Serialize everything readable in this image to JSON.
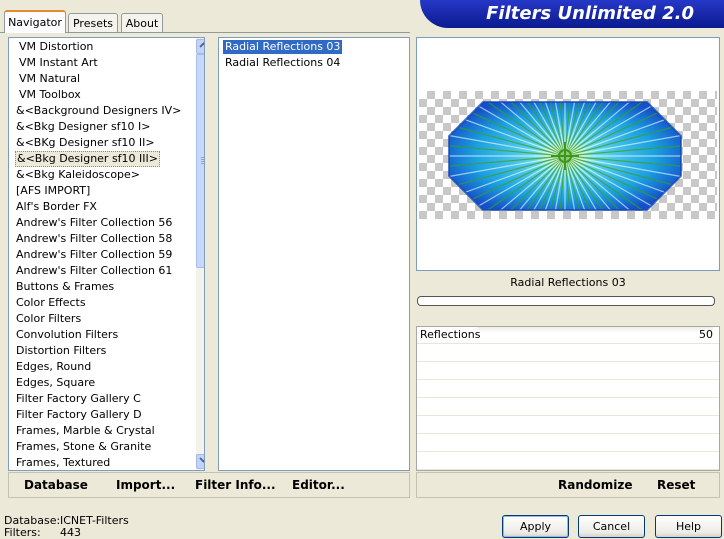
{
  "tabs": [
    {
      "label": "Navigator",
      "active": true
    },
    {
      "label": "Presets",
      "active": false
    },
    {
      "label": "About",
      "active": false
    }
  ],
  "banner": {
    "title": "Filters Unlimited 2.0"
  },
  "categories": {
    "items": [
      "VM Distortion",
      "VM Instant Art",
      "VM Natural",
      "VM Toolbox",
      "&<Background Designers IV>",
      "&<Bkg Designer sf10 I>",
      "&<BKg Designer sf10 II>",
      "&<Bkg Designer sf10 III>",
      "&<Bkg Kaleidoscope>",
      "[AFS IMPORT]",
      "Alf's Border FX",
      "Andrew's Filter Collection 56",
      "Andrew's Filter Collection 58",
      "Andrew's Filter Collection 59",
      "Andrew's Filter Collection 61",
      "Buttons & Frames",
      "Color Effects",
      "Color Filters",
      "Convolution Filters",
      "Distortion Filters",
      "Edges, Round",
      "Edges, Square",
      "Filter Factory Gallery C",
      "Filter Factory Gallery D",
      "Frames, Marble & Crystal",
      "Frames, Stone & Granite",
      "Frames, Textured"
    ],
    "selected_index": 7
  },
  "filters": {
    "items": [
      "Radial Reflections 03",
      "Radial Reflections 04"
    ],
    "selected_index": 0
  },
  "preview": {
    "filter_name": "Radial Reflections 03"
  },
  "params": [
    {
      "label": "Reflections",
      "value": "50"
    }
  ],
  "toolbar_left": {
    "database": "Database",
    "import": "Import...",
    "filter_info": "Filter Info...",
    "editor": "Editor..."
  },
  "toolbar_right": {
    "randomize": "Randomize",
    "reset": "Reset"
  },
  "status": {
    "database_label": "Database:",
    "database_value": "ICNET-Filters",
    "filters_label": "Filters:",
    "filters_value": "443"
  },
  "buttons": {
    "apply": "Apply",
    "cancel": "Cancel",
    "help": "Help"
  },
  "colors": {
    "selection": "#316ac5",
    "banner": "#0b1a8f",
    "accent_tab": "#e68b2c"
  },
  "icons": {
    "scroll_up": "chevron-up-icon",
    "scroll_down": "chevron-down-icon"
  }
}
